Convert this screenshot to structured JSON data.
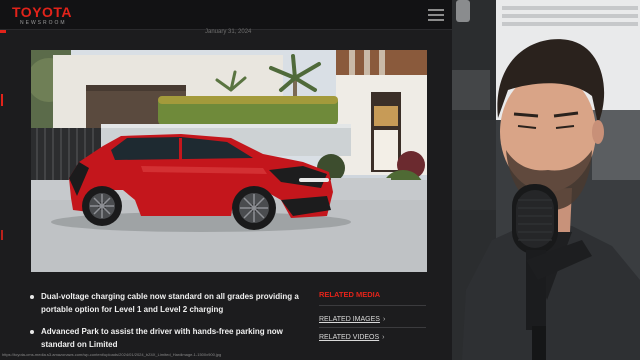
{
  "header": {
    "logo_text": "TOYOTA",
    "logo_subtext": "NEWSROOM",
    "menu_icon": "hamburger-icon"
  },
  "article": {
    "dateline": "January 31, 2024",
    "hero_alt": "Red Toyota bZ4X in front of a modern house"
  },
  "bullets": [
    {
      "text": "Dual-voltage charging cable now standard on all grades providing a portable option for Level 1 and Level 2 charging"
    },
    {
      "text": "Advanced Park to assist the driver with hands-free parking now standard on Limited"
    }
  ],
  "related_media": {
    "title": "RELATED MEDIA",
    "links": [
      {
        "label": "RELATED IMAGES",
        "icon": "chevron-right-icon"
      },
      {
        "label": "RELATED VIDEOS",
        "icon": "chevron-right-icon"
      }
    ]
  },
  "status_bar": {
    "url": "https://toyota-cms-media.s3.amazonaws.com/wp-content/uploads/2024/01/2024_bZ4X_Limited_Hardimage-1-1500x900.jpg"
  },
  "colors": {
    "brand_red": "#e2231a",
    "page_bg": "#1c1c1e"
  }
}
